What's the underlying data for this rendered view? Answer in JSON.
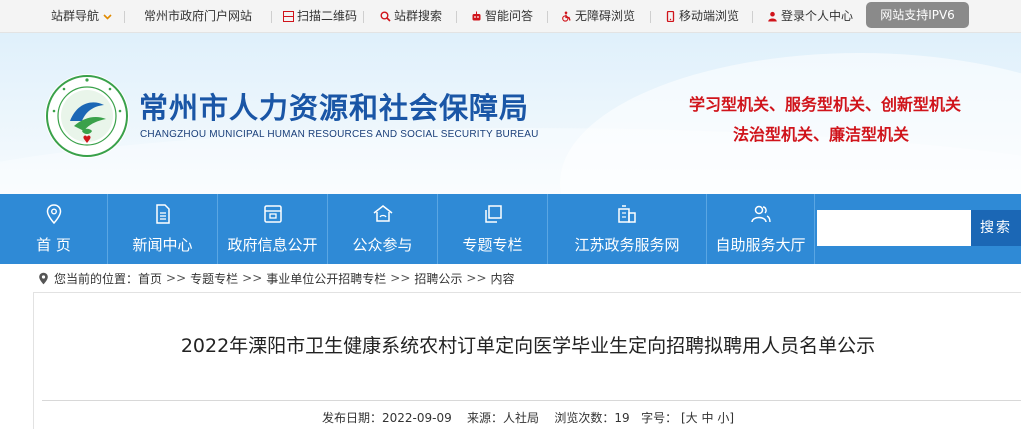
{
  "topbar": {
    "site_nav": "站群导航",
    "gov_portal": "常州市政府门户网站",
    "qrcode": "扫描二维码",
    "site_search": "站群搜索",
    "qa": "智能问答",
    "accessible": "无障碍浏览",
    "mobile": "移动端浏览",
    "login": "登录个人中心",
    "ipv6": "网站支持IPV6"
  },
  "header": {
    "title": "常州市人力资源和社会保障局",
    "subtitle": "CHANGZHOU MUNICIPAL HUMAN RESOURCES AND SOCIAL SECURITY BUREAU",
    "slogan_line1": "学习型机关、服务型机关、创新型机关",
    "slogan_line2": "法治型机关、廉洁型机关"
  },
  "nav": {
    "items": [
      {
        "label": "首 页",
        "icon": "location-pin-icon"
      },
      {
        "label": "新闻中心",
        "icon": "document-icon"
      },
      {
        "label": "政府信息公开",
        "icon": "folder-icon"
      },
      {
        "label": "公众参与",
        "icon": "house-icon"
      },
      {
        "label": "专题专栏",
        "icon": "copy-icon"
      },
      {
        "label": "江苏政务服务网",
        "icon": "building-icon"
      },
      {
        "label": "自助服务大厅",
        "icon": "users-icon"
      }
    ],
    "search_placeholder": "",
    "search_label": "搜索"
  },
  "breadcrumb": {
    "prefix": "您当前的位置：",
    "items": [
      "首页",
      "专题专栏",
      "事业单位公开招聘专栏",
      "招聘公示",
      "内容"
    ],
    "separator": ">>"
  },
  "article": {
    "title": "2022年溧阳市卫生健康系统农村订单定向医学毕业生定向招聘拟聘用人员名单公示",
    "meta": {
      "date_label": "发布日期：",
      "date": "2022-09-09",
      "source_label": "来源：",
      "source": "人社局",
      "views_label": "浏览次数：",
      "views": "19",
      "fontsize_label": "字号：",
      "size_large": "大",
      "size_medium": "中",
      "size_small": "小"
    }
  },
  "colors": {
    "nav_blue": "#2f8ad6",
    "title_blue": "#1a56a6",
    "slogan_red": "#d0141b",
    "search_button": "#1b67b5"
  }
}
